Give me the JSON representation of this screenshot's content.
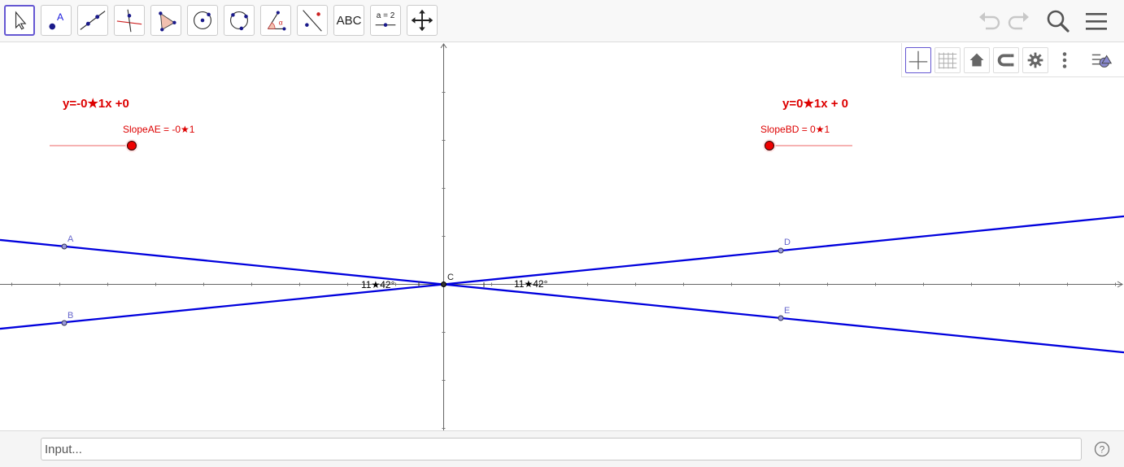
{
  "toolbar": {
    "tools": [
      {
        "name": "move-tool-icon",
        "active": true
      },
      {
        "name": "point-tool-icon"
      },
      {
        "name": "line-tool-icon"
      },
      {
        "name": "perpendicular-line-tool-icon"
      },
      {
        "name": "polygon-tool-icon"
      },
      {
        "name": "circle-center-point-tool-icon"
      },
      {
        "name": "circle-three-points-tool-icon"
      },
      {
        "name": "angle-tool-icon"
      },
      {
        "name": "reflect-tool-icon"
      },
      {
        "name": "text-tool-icon",
        "label": "ABC"
      },
      {
        "name": "slider-tool-icon",
        "label": "a = 2"
      },
      {
        "name": "move-graphics-view-tool-icon"
      }
    ],
    "right_icons": [
      "undo-icon",
      "redo-icon",
      "search-icon",
      "menu-icon"
    ]
  },
  "stylebar": {
    "buttons": [
      "axes-toggle-icon",
      "grid-toggle-icon",
      "home-icon",
      "point-capturing-icon",
      "settings-icon",
      "more-vertical-icon",
      "stylebar-toggle-icon"
    ]
  },
  "graphics": {
    "eq_left": "y=-0★1x +0",
    "eq_right": "y=0★1x + 0",
    "slider_left_label": "SlopeAE = -0★1",
    "slider_right_label": "SlopeBD = 0★1",
    "slope_ae": -0.1,
    "slope_bd": 0.1,
    "angle_left": "11★42°",
    "angle_right": "11★42°",
    "points": {
      "A": "A",
      "B": "B",
      "C": "C",
      "D": "D",
      "E": "E"
    }
  },
  "input": {
    "placeholder": "Input..."
  },
  "colors": {
    "line": "#0000dd",
    "slider": "#ee0000",
    "label_red": "#dd0000",
    "point_label": "#6666cc",
    "active_border": "#6557d2"
  }
}
